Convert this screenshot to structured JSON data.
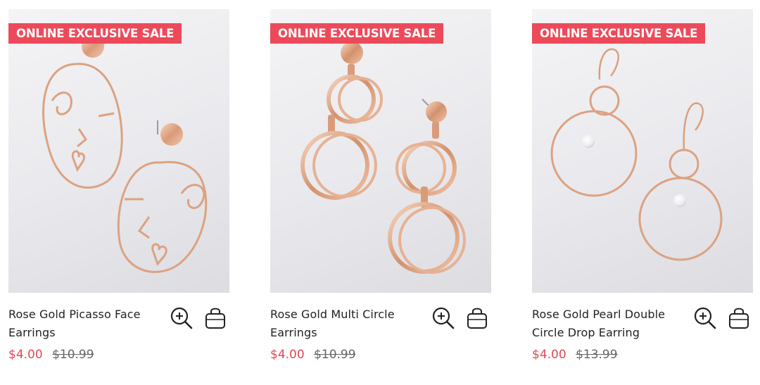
{
  "colors": {
    "badge_bg": "#ec4a5a",
    "sale_price": "#e0475a",
    "original_price": "#666666",
    "text": "#222222",
    "metal": "#e9b597"
  },
  "products": [
    {
      "badge": "ONLINE EXCLUSIVE SALE",
      "title_line1": "Rose Gold Picasso Face",
      "title_line2": "Earrings",
      "sale_price": "$4.00",
      "original_price": "$10.99",
      "zoom_icon": "zoom-in-icon",
      "bag_icon": "shopping-bag-icon"
    },
    {
      "badge": "ONLINE EXCLUSIVE SALE",
      "title_line1": "Rose Gold Multi Circle",
      "title_line2": "Earrings",
      "sale_price": "$4.00",
      "original_price": "$10.99",
      "zoom_icon": "zoom-in-icon",
      "bag_icon": "shopping-bag-icon"
    },
    {
      "badge": "ONLINE EXCLUSIVE SALE",
      "title_line1": "Rose Gold Pearl Double",
      "title_line2": "Circle Drop Earring",
      "sale_price": "$4.00",
      "original_price": "$13.99",
      "zoom_icon": "zoom-in-icon",
      "bag_icon": "shopping-bag-icon"
    }
  ]
}
